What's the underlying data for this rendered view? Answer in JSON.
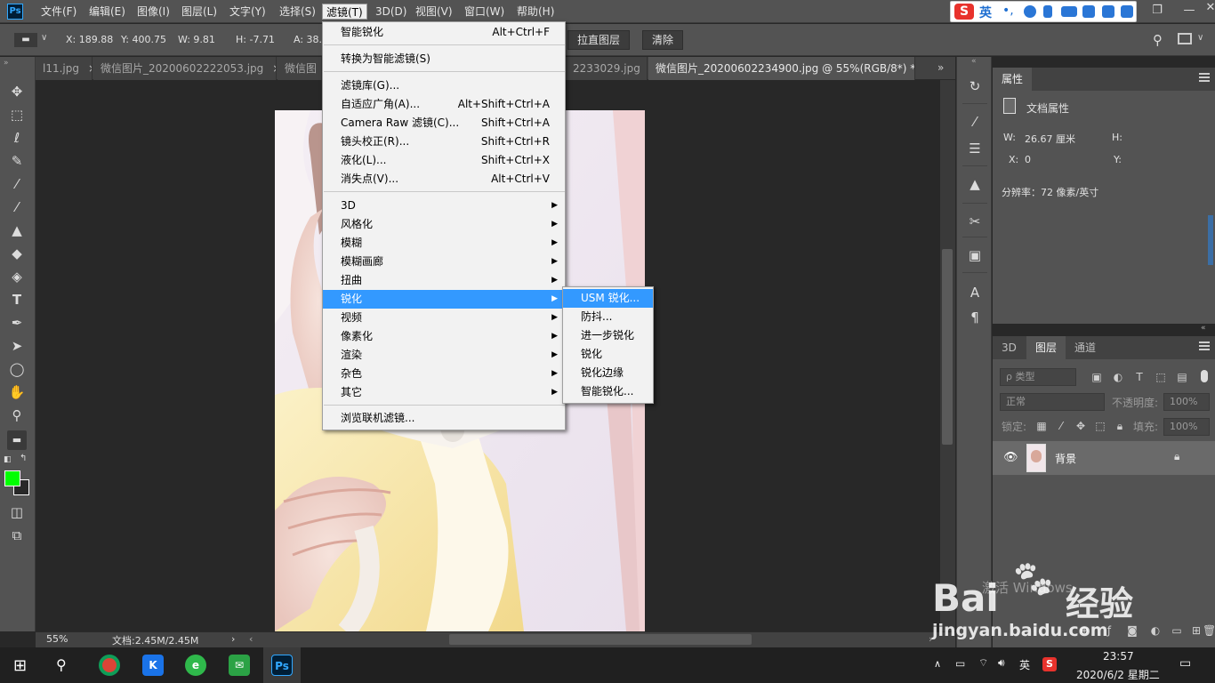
{
  "menubar": {
    "items": [
      "文件(F)",
      "编辑(E)",
      "图像(I)",
      "图层(L)",
      "文字(Y)",
      "选择(S)",
      "滤镜(T)",
      "3D(D)",
      "视图(V)",
      "窗口(W)",
      "帮助(H)"
    ],
    "active_index": 6
  },
  "ime": {
    "lang": "英"
  },
  "options": {
    "x": "X: 189.88",
    "y": "Y: 400.75",
    "w": "W: 9.81",
    "h": "H: -7.71",
    "a": "A: 38.",
    "straighten_btn": "拉直图层",
    "clear_btn": "清除"
  },
  "tabs": [
    {
      "label": "l11.jpg"
    },
    {
      "label": "微信图片_20200602222053.jpg"
    },
    {
      "label": "微信图"
    },
    {
      "label": "2233029.jpg"
    },
    {
      "label": "微信图片_20200602234900.jpg @ 55%(RGB/8*) *"
    }
  ],
  "filter_menu": {
    "items": [
      {
        "label": "智能锐化",
        "shortcut": "Alt+Ctrl+F"
      },
      {
        "label": "转换为智能滤镜(S)",
        "shortcut": ""
      },
      {
        "label": "滤镜库(G)...",
        "shortcut": ""
      },
      {
        "label": "自适应广角(A)...",
        "shortcut": "Alt+Shift+Ctrl+A"
      },
      {
        "label": "Camera Raw 滤镜(C)...",
        "shortcut": "Shift+Ctrl+A"
      },
      {
        "label": "镜头校正(R)...",
        "shortcut": "Shift+Ctrl+R"
      },
      {
        "label": "液化(L)...",
        "shortcut": "Shift+Ctrl+X"
      },
      {
        "label": "消失点(V)...",
        "shortcut": "Alt+Ctrl+V"
      },
      {
        "label": "3D",
        "shortcut": ""
      },
      {
        "label": "风格化",
        "shortcut": ""
      },
      {
        "label": "模糊",
        "shortcut": ""
      },
      {
        "label": "模糊画廊",
        "shortcut": ""
      },
      {
        "label": "扭曲",
        "shortcut": ""
      },
      {
        "label": "锐化",
        "shortcut": ""
      },
      {
        "label": "视频",
        "shortcut": ""
      },
      {
        "label": "像素化",
        "shortcut": ""
      },
      {
        "label": "渲染",
        "shortcut": ""
      },
      {
        "label": "杂色",
        "shortcut": ""
      },
      {
        "label": "其它",
        "shortcut": ""
      },
      {
        "label": "浏览联机滤镜...",
        "shortcut": ""
      }
    ]
  },
  "sharpen_submenu": {
    "items": [
      "USM 锐化...",
      "防抖...",
      "进一步锐化",
      "锐化",
      "锐化边缘",
      "智能锐化..."
    ]
  },
  "properties": {
    "tab": "属性",
    "doc_props": "文档属性",
    "w_label": "W:",
    "w_value": "26.67 厘米",
    "h_label": "H:",
    "x_label": "X:",
    "x_value": "0",
    "y_label": "Y:",
    "resolution": "分辨率：72 像素/英寸"
  },
  "layers": {
    "tabs": [
      "3D",
      "图层",
      "通道"
    ],
    "filter_kind": "ρ 类型",
    "blend_mode": "正常",
    "opacity_label": "不透明度:",
    "opacity_value": "100%",
    "lock_label": "锁定:",
    "fill_label": "填充:",
    "fill_value": "100%",
    "layer_name": "背景"
  },
  "status": {
    "zoom": "55%",
    "doc_info": "文档:2.45M/2.45M"
  },
  "watermark": {
    "activate": "激活 Windows",
    "baidu": "Bai",
    "jingyan": "经验",
    "url": "jingyan.baidu.com"
  },
  "taskbar": {
    "lang": "英",
    "time": "23:57",
    "date": "2020/6/2 星期二",
    "ps_label": "Ps"
  },
  "colors": {
    "foreground": "#00ff00",
    "highlight": "#3399ff"
  }
}
